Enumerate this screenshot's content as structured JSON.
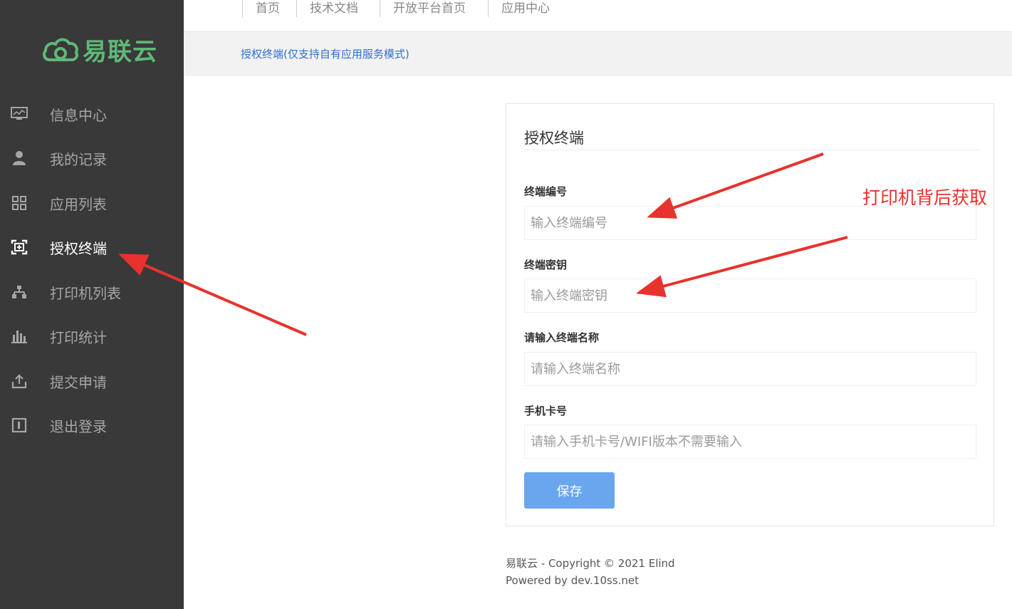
{
  "brand": {
    "name": "易联云",
    "color": "#5fb878"
  },
  "sidebar": {
    "items": [
      {
        "label": "信息中心",
        "icon": "monitor-icon"
      },
      {
        "label": "我的记录",
        "icon": "user-icon"
      },
      {
        "label": "应用列表",
        "icon": "grid-icon"
      },
      {
        "label": "授权终端",
        "icon": "terminal-icon",
        "active": true
      },
      {
        "label": "打印机列表",
        "icon": "sitemap-icon"
      },
      {
        "label": "打印统计",
        "icon": "bar-chart-icon"
      },
      {
        "label": "提交申请",
        "icon": "upload-icon"
      },
      {
        "label": "退出登录",
        "icon": "logout-icon"
      }
    ]
  },
  "topnav": {
    "items": [
      "首页",
      "技术文档",
      "开放平台首页",
      "应用中心"
    ]
  },
  "breadcrumb": "授权终端(仅支持自有应用服务模式)",
  "form": {
    "title": "授权终端",
    "fields": [
      {
        "label": "终端编号",
        "placeholder": "输入终端编号"
      },
      {
        "label": "终端密钥",
        "placeholder": "输入终端密钥"
      },
      {
        "label": "请输入终端名称",
        "placeholder": "请输入终端名称"
      },
      {
        "label": "手机卡号",
        "placeholder": "请输入手机卡号/WIFI版本不需要输入"
      }
    ],
    "save_label": "保存"
  },
  "footer": {
    "line1": "易联云 - Copyright © 2021 Elind",
    "line2": "Powered by dev.10ss.net"
  },
  "annotation": "打印机背后获取",
  "colors": {
    "sidebar_bg": "#393939",
    "accent_red": "#e8322d",
    "button": "#6aa6ee",
    "link": "#2f6fd0"
  }
}
